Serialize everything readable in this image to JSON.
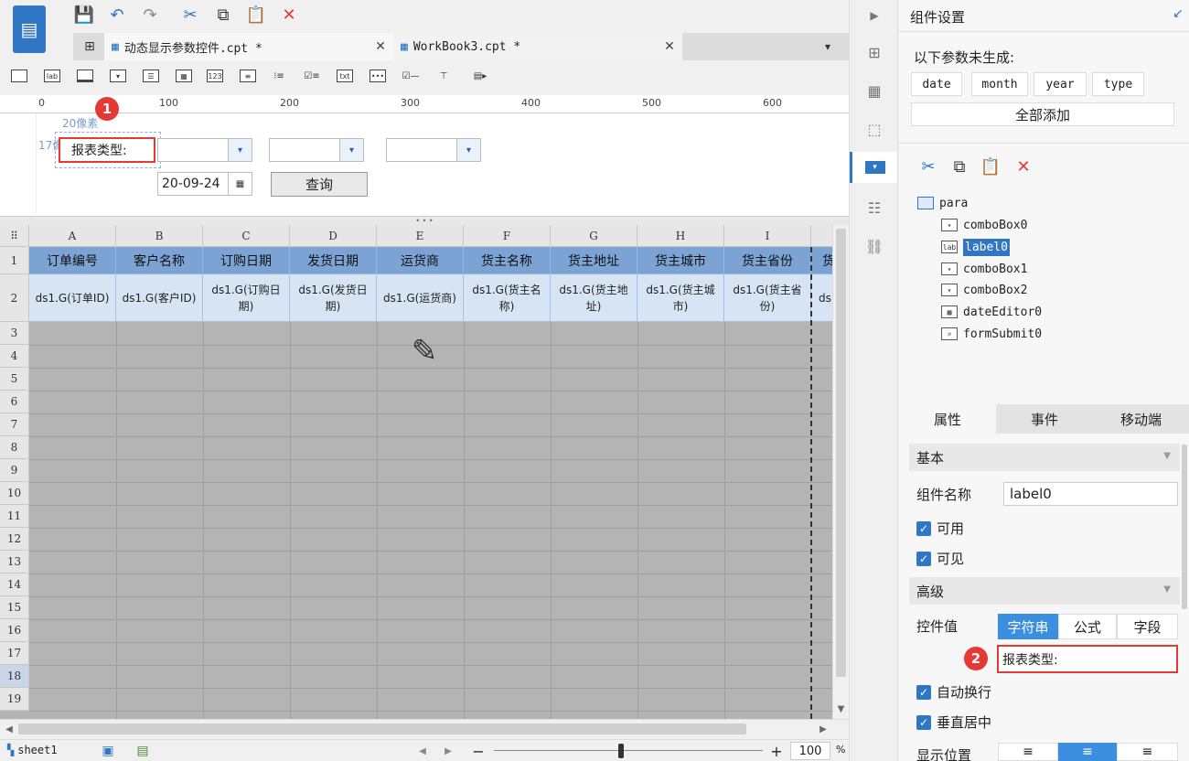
{
  "toolbar": {
    "icons": [
      "save-icon",
      "undo-icon",
      "redo-icon",
      "cut-icon",
      "copy-icon",
      "paste-icon",
      "delete-icon"
    ]
  },
  "tabs": [
    {
      "label": "动态显示参数控件.cpt *"
    },
    {
      "label": "WorkBook3.cpt *"
    }
  ],
  "ruler": {
    "ticks": [
      "0",
      "100",
      "200",
      "300",
      "400",
      "500",
      "600"
    ]
  },
  "design": {
    "pixel_hint_h": "20像素",
    "pixel_hint_v": "17像素",
    "label_text": "报表类型:",
    "date_value": "20-09-24",
    "query_button": "查询",
    "marker1": "1"
  },
  "grid": {
    "columns": [
      "A",
      "B",
      "C",
      "D",
      "E",
      "F",
      "G",
      "H",
      "I"
    ],
    "header_row": [
      "订单编号",
      "客户名称",
      "订购日期",
      "发货日期",
      "运货商",
      "货主名称",
      "货主地址",
      "货主城市",
      "货主省份"
    ],
    "data_row": [
      "ds1.G(订单ID)",
      "ds1.G(客户ID)",
      "ds1.G(订购日期)",
      "ds1.G(发货日期)",
      "ds1.G(运货商)",
      "ds1.G(货主名称)",
      "ds1.G(货主地址)",
      "ds1.G(货主城市)",
      "ds1.G(货主省份)"
    ],
    "row_numbers": [
      "1",
      "2",
      "3",
      "4",
      "5",
      "6",
      "7",
      "8",
      "9",
      "10",
      "11",
      "12",
      "13",
      "14",
      "15",
      "16",
      "17",
      "18",
      "19"
    ],
    "partial_header": "货",
    "partial_data": "ds"
  },
  "status": {
    "sheet": "sheet1",
    "zoom": "100",
    "zoom_unit": "%"
  },
  "panel": {
    "title": "组件设置",
    "ungenerated_label": "以下参数未生成:",
    "params": [
      "date",
      "month",
      "year",
      "type"
    ],
    "add_all": "全部添加",
    "tree_root": "para",
    "tree_items": [
      "comboBox0",
      "label0",
      "comboBox1",
      "comboBox2",
      "dateEditor0",
      "formSubmit0"
    ],
    "tabs": [
      "属性",
      "事件",
      "移动端"
    ],
    "section_basic": "基本",
    "name_label": "组件名称",
    "name_value": "label0",
    "enabled": "可用",
    "visible": "可见",
    "section_advanced": "高级",
    "value_label": "控件值",
    "value_types": [
      "字符串",
      "公式",
      "字段"
    ],
    "value_text": "报表类型:",
    "marker2": "2",
    "auto_wrap": "自动换行",
    "vcenter": "垂直居中",
    "display_pos": "显示位置"
  }
}
